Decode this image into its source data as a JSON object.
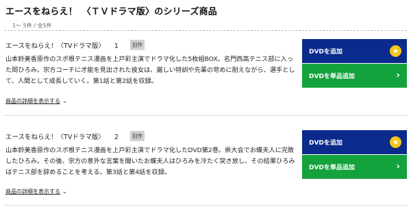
{
  "header": {
    "title": "エースをねらえ！　〈ＴＶドラマ版〉のシリーズ商品",
    "count": "1～ 5件 / 全5件"
  },
  "items": [
    {
      "title": "エースをねらえ！〈TVドラマ版〉",
      "number": "1",
      "badge": "旧作",
      "description": "山本鈴美香原作のスポ根テニス漫画を上戸彩主演でドラマ化した5枚組BOX。名門西高テニス部に入った岡ひろみ。宗方コーチに才能を見出された彼女は、厳しい特訓や先輩の苛めに耐えながら、選手として、人間として成長していく。第1話と第2話を収録。",
      "detail_link": "商品の詳細を表示する",
      "add_button": "DVDを追加",
      "single_button": "DVDを単品追加"
    },
    {
      "title": "エースをねらえ！〈TVドラマ版〉",
      "number": "2",
      "badge": "旧作",
      "description": "山本鈴美香原作のスポ根テニス漫画を上戸彩主演でドラマ化したDVD第2巻。県大会でお蝶夫人に完敗したひろみ。その後、宗方の意外な言葉を聞いたお蝶夫人はひろみを冷たく突き放し、その結果ひろみはテニス部を辞めることを考える。第3話と第4話を収録。",
      "detail_link": "商品の詳細を表示する",
      "add_button": "DVDを追加",
      "single_button": "DVDを単品追加"
    }
  ],
  "icons": {
    "star": "star-icon",
    "chevron_right": "chevron-right-icon",
    "chevron_down": "chevron-down-icon"
  },
  "colors": {
    "add_button": "#0a2a8c",
    "single_button": "#14a23c",
    "star": "#f5c518",
    "badge": "#d0d0d0"
  }
}
